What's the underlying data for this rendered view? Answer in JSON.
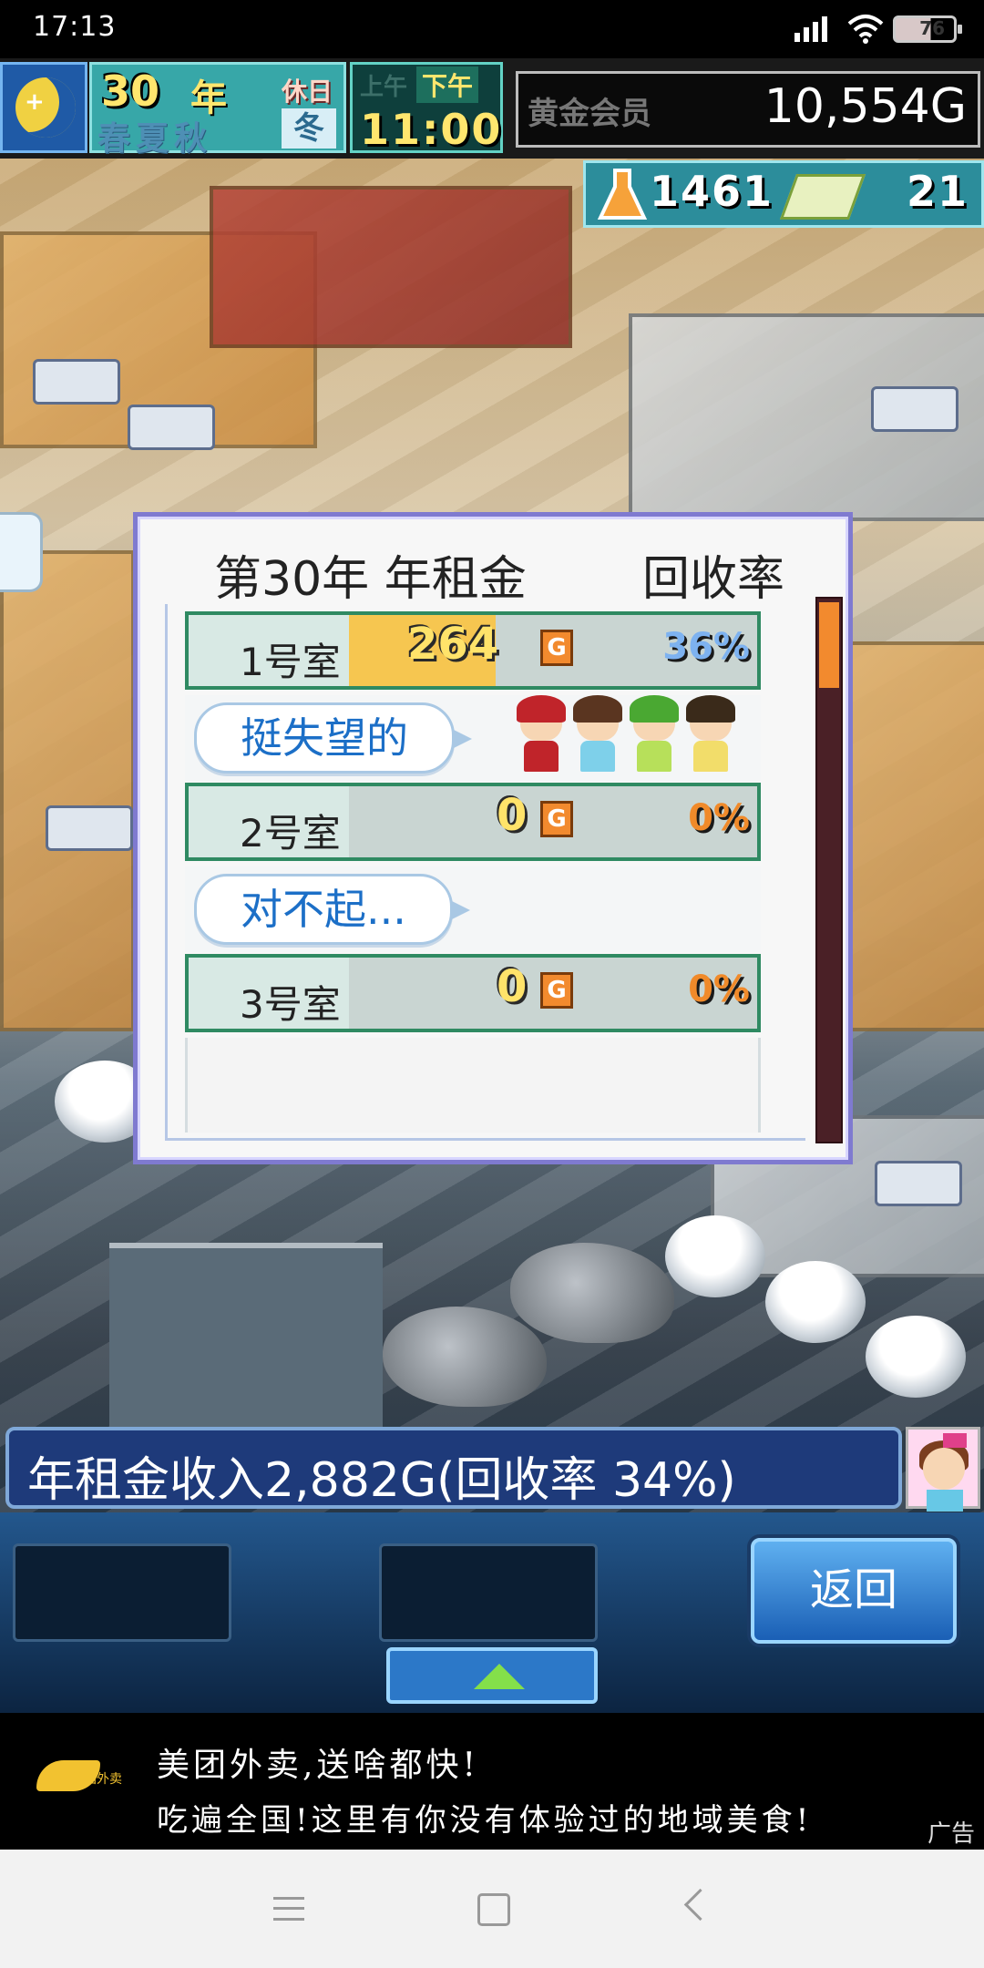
{
  "status_bar": {
    "time": "17:13",
    "battery": "76"
  },
  "hud": {
    "year_number": "30",
    "year_suffix": "年",
    "holiday": "休日",
    "seasons": "春夏秋",
    "current_season": "冬",
    "am_label": "上午",
    "pm_label": "下午",
    "clock": "11:00",
    "membership": "黄金会员",
    "money": "10,554G",
    "research_points": "1461",
    "tickets": "21"
  },
  "dialog": {
    "title": "第30年 年租金",
    "rate_header": "回收率",
    "rooms": [
      {
        "label": "1号室",
        "amount": "264",
        "currency": "G",
        "rate": "36%",
        "rate_color": "#7db2f0",
        "fill_fraction": 0.36,
        "comment": "挺失望的"
      },
      {
        "label": "2号室",
        "amount": "0",
        "currency": "G",
        "rate": "0%",
        "rate_color": "#f08a2a",
        "fill_fraction": 0.0,
        "comment": "对不起..."
      },
      {
        "label": "3号室",
        "amount": "0",
        "currency": "G",
        "rate": "0%",
        "rate_color": "#f08a2a",
        "fill_fraction": 0.0
      }
    ]
  },
  "message": "年租金收入2,882G(回收率 34%)",
  "controls": {
    "back_label": "返回"
  },
  "ad": {
    "brand": "美团外卖",
    "line1": "美团外卖,送啥都快!",
    "line2": "吃遍全国!这里有你没有体验过的地域美食!",
    "tag": "广告"
  },
  "colors": {
    "accent": "#1e3a7a",
    "dialog_border": "#7f7ad0",
    "row_border": "#2f8a62"
  }
}
